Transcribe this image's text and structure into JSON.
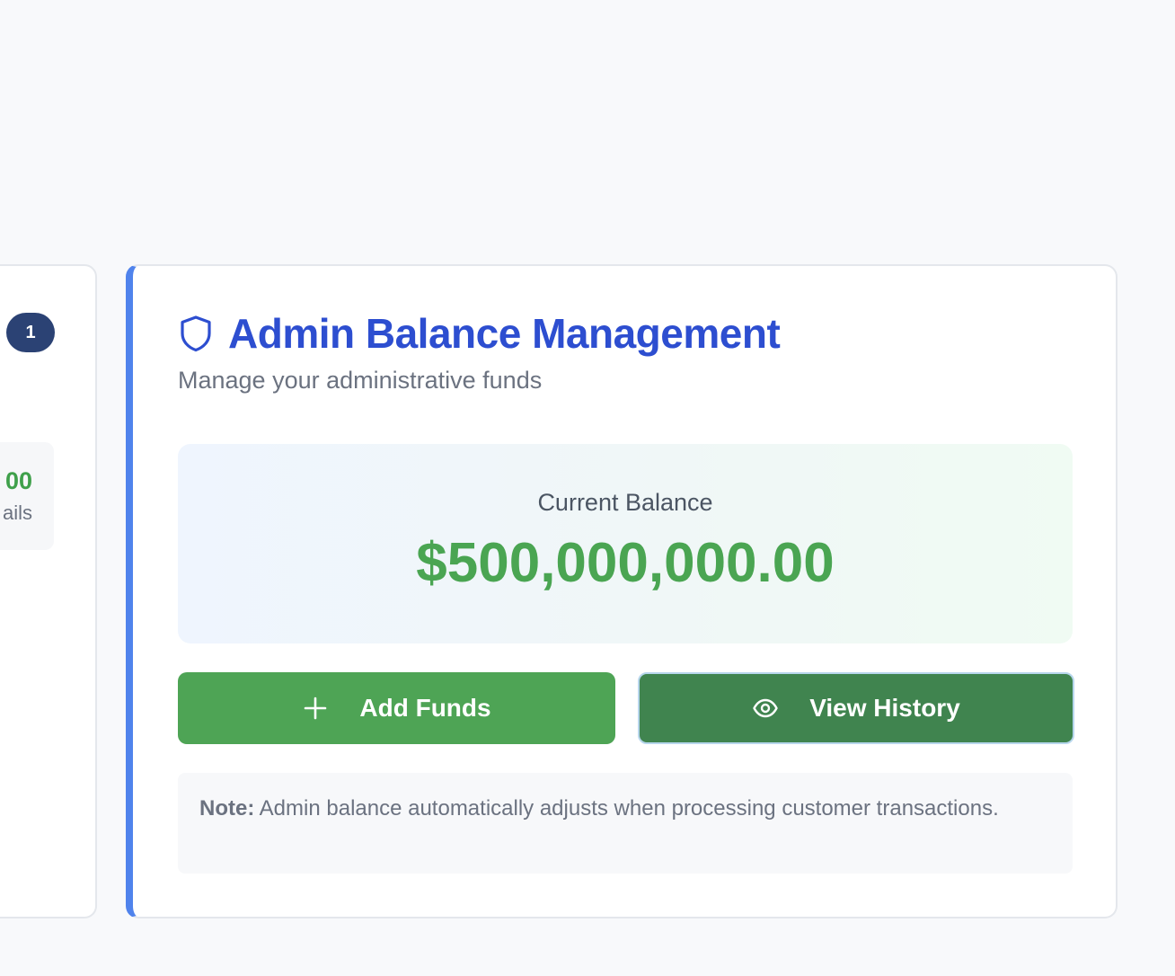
{
  "left_card": {
    "badge": "1",
    "amount_fragment": "00",
    "sub_fragment": "ails"
  },
  "admin": {
    "title": "Admin Balance Management",
    "subtitle": "Manage your administrative funds",
    "balance_label": "Current Balance",
    "balance_value": "$500,000,000.00",
    "add_funds_label": "Add Funds",
    "view_history_label": "View History",
    "note_label": "Note:",
    "note_text": "Admin balance automatically adjusts when processing customer transactions."
  },
  "icons": {
    "title": "shield-icon",
    "add": "plus-icon",
    "history": "eye-icon"
  },
  "colors": {
    "accent_blue": "#2d4ed0",
    "border_accent": "#5083ec",
    "balance_green": "#4aa552",
    "add_button": "#4ea455",
    "history_button": "#40844f",
    "badge": "#2b4274"
  }
}
